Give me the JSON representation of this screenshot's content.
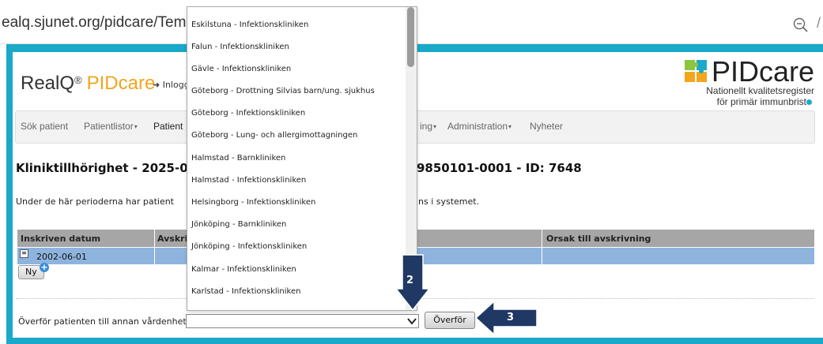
{
  "browser": {
    "url": "ealq.sjunet.org/pidcare/Template",
    "zoom_icon": "zoom-out-icon",
    "slash": "/"
  },
  "header": {
    "brand_realq": "RealQ",
    "brand_reg": "®",
    "brand_pidcare": "PIDcare",
    "login_link": "➜ Inlogg",
    "logo_text": "PIDcare",
    "logo_tagline1": "Nationellt kvalitetsregister",
    "logo_tagline2": "för primär immunbrist"
  },
  "nav": {
    "items": [
      {
        "label": "Sök patient"
      },
      {
        "label": "Patientlistor",
        "caret": "▾"
      },
      {
        "label": "Patient"
      },
      {
        "label": "ing",
        "caret": "▾"
      },
      {
        "label": "Administration",
        "caret": "▾"
      },
      {
        "label": "Nyheter"
      }
    ]
  },
  "main": {
    "title_left": "Kliniktillhörighet - 2025-0",
    "title_right": "9850101-0001 - ID: 7648",
    "info_left": "Under de här perioderna har patient",
    "info_right": "ns i systemet."
  },
  "table": {
    "headers": [
      "Inskriven datum",
      "Avskri",
      "Orsak till avskrivning"
    ],
    "row": {
      "date": "2002-06-01",
      "expand_icon": "expand-icon"
    }
  },
  "buttons": {
    "new_label": "Ny",
    "new_icon": "plus-icon",
    "transfer_label": "Överför"
  },
  "transfer": {
    "label": "Överför patienten till annan vårdenhet:",
    "selected": ""
  },
  "dropdown": {
    "options": [
      "Eskilstuna - Infektionskliniken",
      "Falun - Infektionskliniken",
      "Gävle - Infektionskliniken",
      "Göteborg - Drottning Silvias barn/ung. sjukhus",
      "Göteborg - Infektionskliniken",
      "Göteborg - Lung- och allergimottagningen",
      "Halmstad - Barnkliniken",
      "Halmstad - Infektionskliniken",
      "Helsingborg - Infektionskliniken",
      "Jönköping - Barnkliniken",
      "Jönköping - Infektionskliniken",
      "Kalmar - Infektionskliniken",
      "Karlstad - Infektionskliniken"
    ]
  },
  "annotations": {
    "step2": "2",
    "step3": "3",
    "color": "#1f3864"
  }
}
